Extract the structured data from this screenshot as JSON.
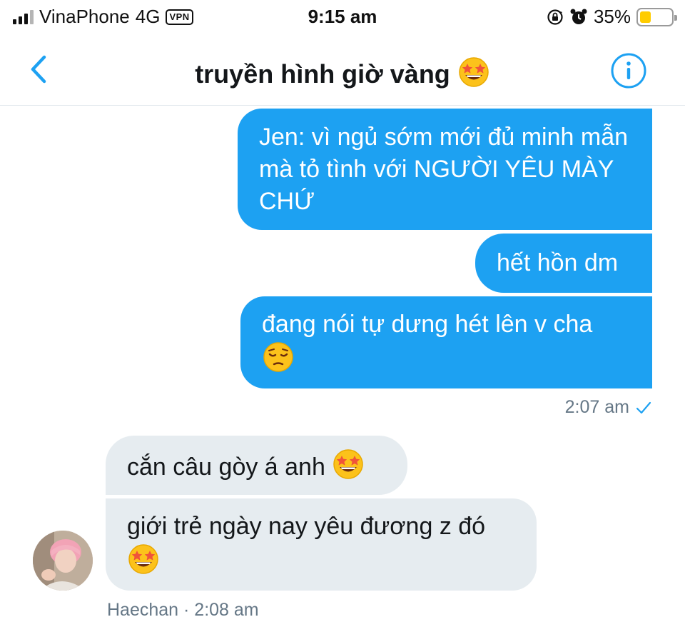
{
  "status_bar": {
    "carrier": "VinaPhone",
    "network": "4G",
    "vpn": "VPN",
    "time": "9:15 am",
    "battery_percent": "35%",
    "battery_level": 0.35,
    "icons": [
      "signal-icon",
      "orientation-lock-icon",
      "alarm-icon",
      "battery-icon"
    ]
  },
  "nav": {
    "back_icon": "chevron-left-icon",
    "title": "truyền hình giờ vàng",
    "title_emoji": "star-struck-emoji",
    "info_icon": "info-icon"
  },
  "messages": {
    "sent": [
      {
        "text": "Jen: vì ngủ sớm mới đủ minh mẫn mà tỏ tình với NGƯỜI YÊU MÀY CHỨ"
      },
      {
        "text": "hết hồn dm"
      },
      {
        "text": "đang nói tự dưng hét lên v cha",
        "emoji": "pensive-face-emoji"
      }
    ],
    "sent_time": "2:07 am",
    "sent_status_icon": "check-icon",
    "received": [
      {
        "text": "cắn câu gòy á anh",
        "emoji": "star-struck-emoji"
      },
      {
        "text": "giới trẻ ngày nay yêu đương z đó",
        "emoji": "star-struck-emoji"
      }
    ],
    "received_meta": "Haechan · 2:08 am"
  },
  "colors": {
    "accent": "#1da1f2",
    "sent_bubble": "#1da1f2",
    "received_bubble": "#e6ecf0",
    "meta_text": "#657786",
    "battery": "#ffcc00"
  }
}
